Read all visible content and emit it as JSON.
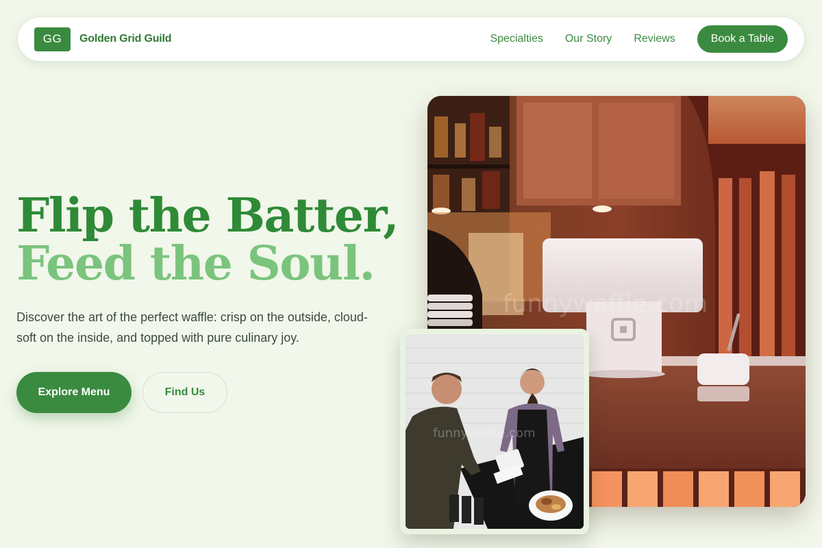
{
  "nav": {
    "logo_initials": "GG",
    "brand_name": "Golden Grid Guild",
    "links": [
      {
        "label": "Specialties"
      },
      {
        "label": "Our Story"
      },
      {
        "label": "Reviews"
      }
    ],
    "cta_label": "Book a Table"
  },
  "hero": {
    "title_line1": "Flip the Batter,",
    "title_line2": "Feed the Soul.",
    "description": "Discover the art of the perfect waffle: crisp on the outside, cloud-soft on the inside, and topped with pure culinary joy.",
    "primary_button": "Explore Menu",
    "secondary_button": "Find Us"
  },
  "images": {
    "main_watermark": "funnywaffle.com",
    "inset_watermark": "funnywaffle.com"
  },
  "colors": {
    "background": "#f1f7ea",
    "brand_green": "#3a8b3f",
    "title_dark_green": "#2f8a37",
    "title_light_green": "#7bc47d"
  }
}
